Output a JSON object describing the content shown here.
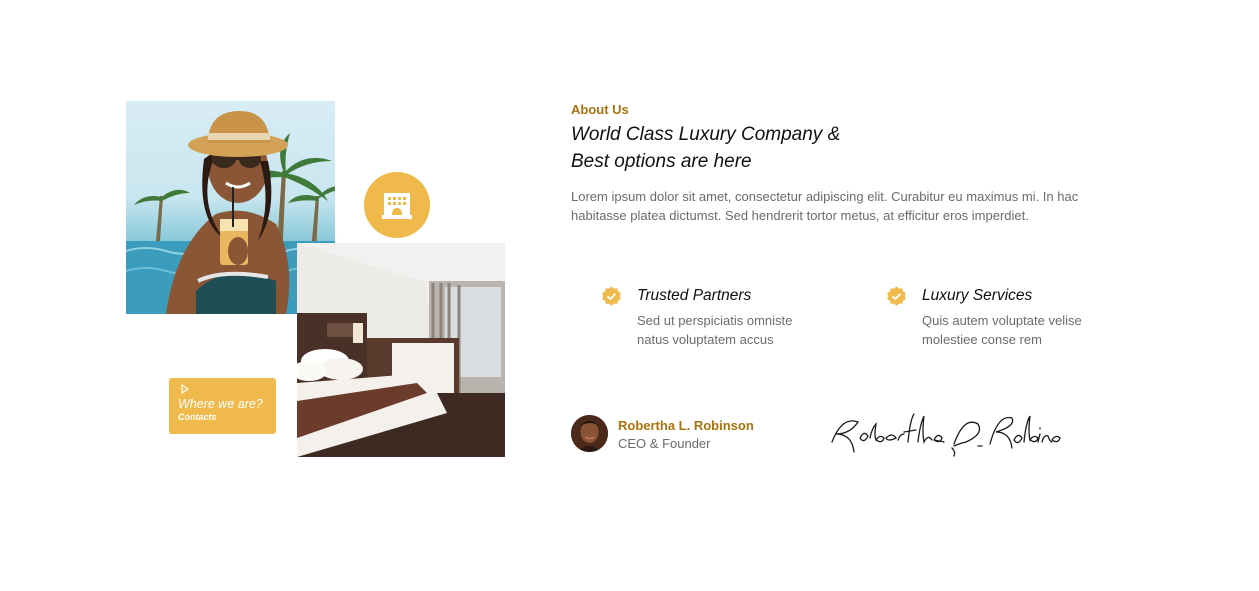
{
  "colors": {
    "accent": "#f0b94c",
    "eyebrow": "#a8720e",
    "heading": "#111111",
    "body": "#6b6b6b"
  },
  "collage": {
    "pool_photo_icon": "woman-in-pool-photo",
    "room_photo_icon": "hotel-bedroom-photo",
    "badge_icon": "hotel-building-icon",
    "card": {
      "icon": "play-icon",
      "title": "Where we are?",
      "link": "Contacts"
    }
  },
  "about": {
    "eyebrow": "About Us",
    "headline_line1": "World Class Luxury Company &",
    "headline_line2": "Best options are here",
    "intro": "Lorem ipsum dolor sit amet, consectetur adipiscing elit. Curabitur eu maximus mi. In hac habitasse platea dictumst. Sed hendrerit tortor metus, at efficitur eros imperdiet."
  },
  "features": [
    {
      "icon": "check-badge-icon",
      "title": "Trusted Partners",
      "desc": "Sed ut perspiciatis omniste natus voluptatem accus"
    },
    {
      "icon": "check-badge-icon",
      "title": "Luxury Services",
      "desc": "Quis autem voluptate velise molestiee conse rem"
    }
  ],
  "author": {
    "name": "Robertha L. Robinson",
    "role": "CEO & Founder",
    "signature": "Robertha L. Robinson"
  }
}
